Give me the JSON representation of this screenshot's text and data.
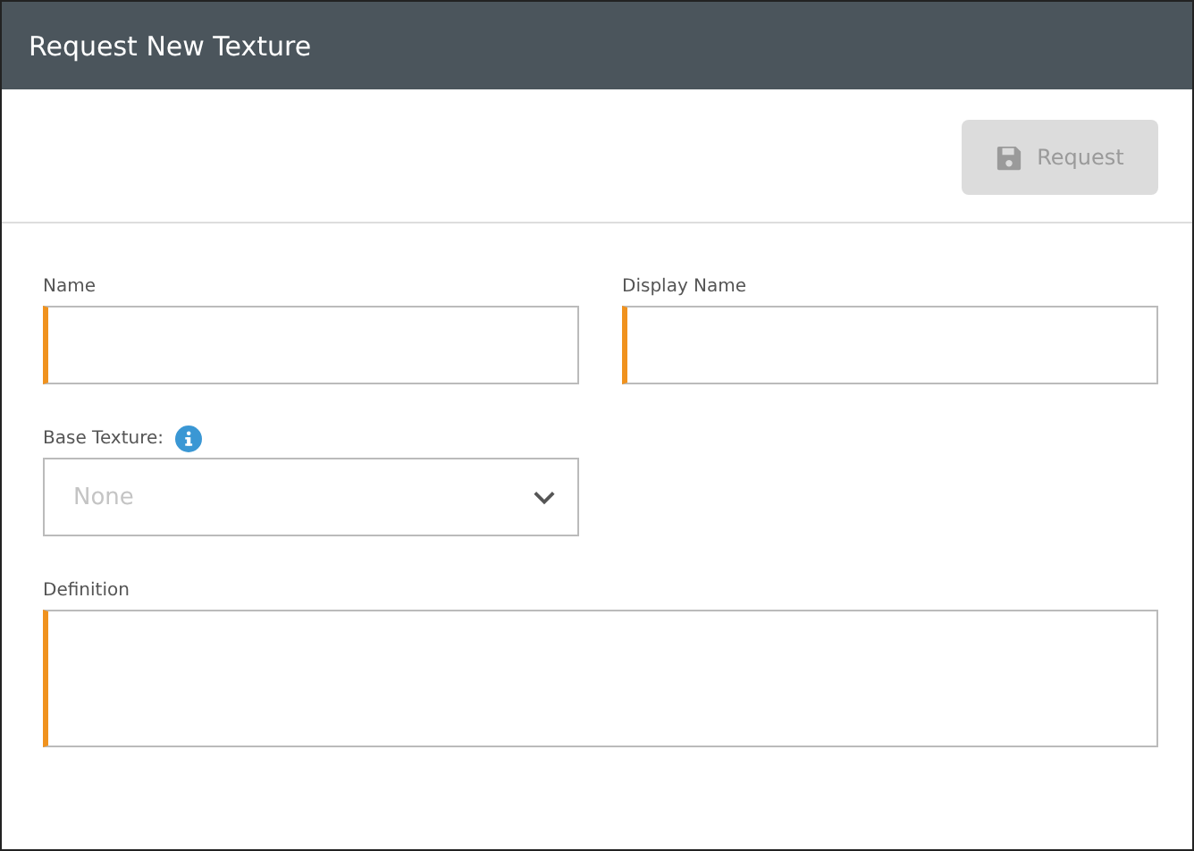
{
  "window": {
    "title": "Request New Texture"
  },
  "toolbar": {
    "request_button": {
      "label": "Request",
      "disabled": true
    }
  },
  "fields": [
    {
      "kind": "text",
      "label": "Name",
      "required": true,
      "info": false
    },
    {
      "kind": "text",
      "label": "Display Name",
      "required": true,
      "info": false
    },
    {
      "kind": "select",
      "label": "Base Texture:",
      "required": false,
      "info": true,
      "placeholder": "None"
    },
    {
      "kind": "textarea",
      "label": "Definition",
      "required": true,
      "info": false
    }
  ]
}
